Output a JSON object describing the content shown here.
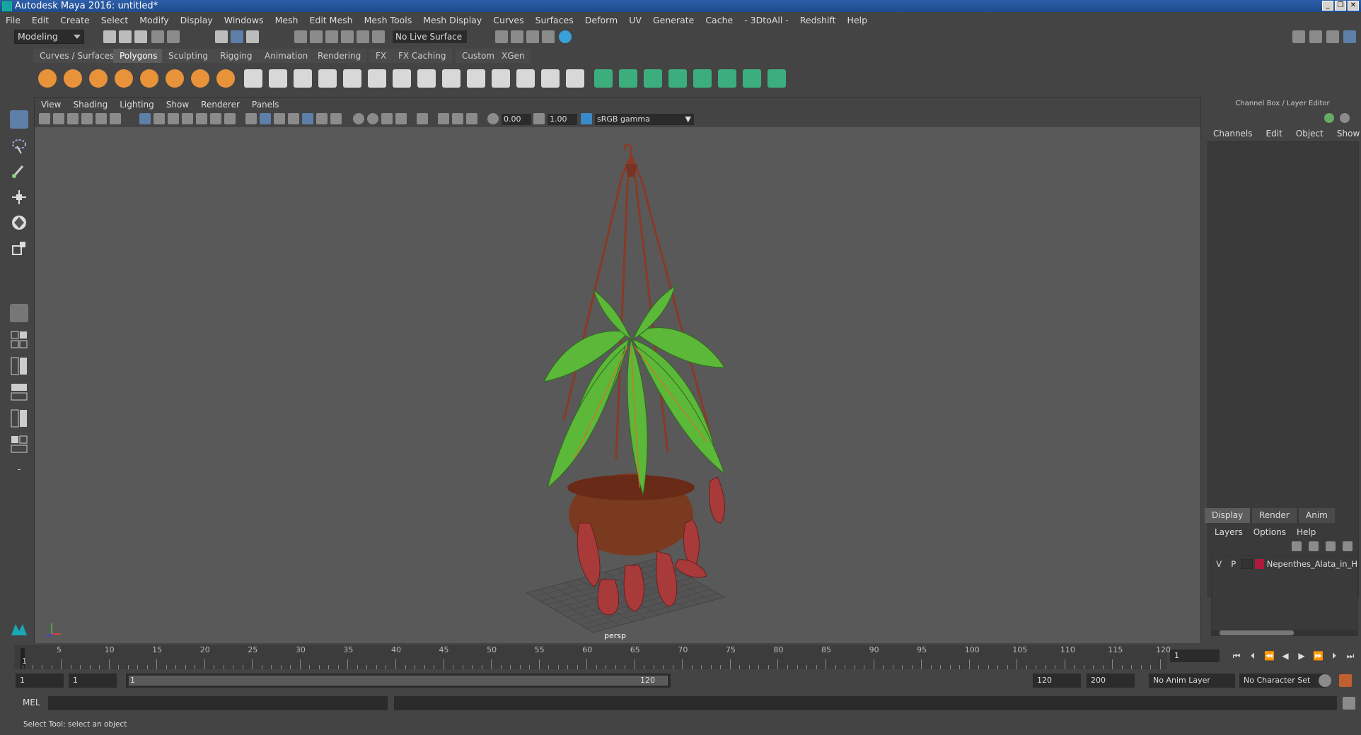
{
  "window": {
    "title": "Autodesk Maya 2016: untitled*"
  },
  "menus": [
    "File",
    "Edit",
    "Create",
    "Select",
    "Modify",
    "Display",
    "Windows",
    "Mesh",
    "Edit Mesh",
    "Mesh Tools",
    "Mesh Display",
    "Curves",
    "Surfaces",
    "Deform",
    "UV",
    "Generate",
    "Cache",
    "- 3DtoAll -",
    "Redshift",
    "Help"
  ],
  "status_line": {
    "mode": "Modeling",
    "live_surface": "No Live Surface"
  },
  "shelf": {
    "tabs": [
      "Curves / Surfaces",
      "Polygons",
      "Sculpting",
      "Rigging",
      "Animation",
      "Rendering",
      "FX",
      "FX Caching",
      "Custom",
      "XGen"
    ],
    "active_tab": "Polygons"
  },
  "viewport": {
    "menus": [
      "View",
      "Shading",
      "Lighting",
      "Show",
      "Renderer",
      "Panels"
    ],
    "exposure": "0.00",
    "gamma": "1.00",
    "color_space": "sRGB gamma",
    "camera_label": "persp"
  },
  "channel_box": {
    "title": "Channel Box / Layer Editor",
    "menus": [
      "Channels",
      "Edit",
      "Object",
      "Show"
    ]
  },
  "layer_editor": {
    "tabs": [
      "Display",
      "Render",
      "Anim"
    ],
    "active_tab": "Display",
    "menus": [
      "Layers",
      "Options",
      "Help"
    ],
    "layers": [
      {
        "visible": "V",
        "playback": "P",
        "name": "Nepenthes_Alata_in_H",
        "color": "#b01a3a"
      }
    ]
  },
  "timeline": {
    "ticks": [
      "5",
      "10",
      "15",
      "20",
      "25",
      "30",
      "35",
      "40",
      "45",
      "50",
      "55",
      "60",
      "65",
      "70",
      "75",
      "80",
      "85",
      "90",
      "95",
      "100",
      "105",
      "110",
      "115",
      "120"
    ],
    "first_label": "1",
    "current_frame": "1"
  },
  "range": {
    "start_field": "1",
    "playback_start": "1",
    "slider_start": "1",
    "slider_end": "120",
    "playback_end": "120",
    "end_field": "200",
    "anim_layer": "No Anim Layer",
    "character_set": "No Character Set"
  },
  "command_line": {
    "label": "MEL"
  },
  "help_line": "Select Tool: select an object"
}
